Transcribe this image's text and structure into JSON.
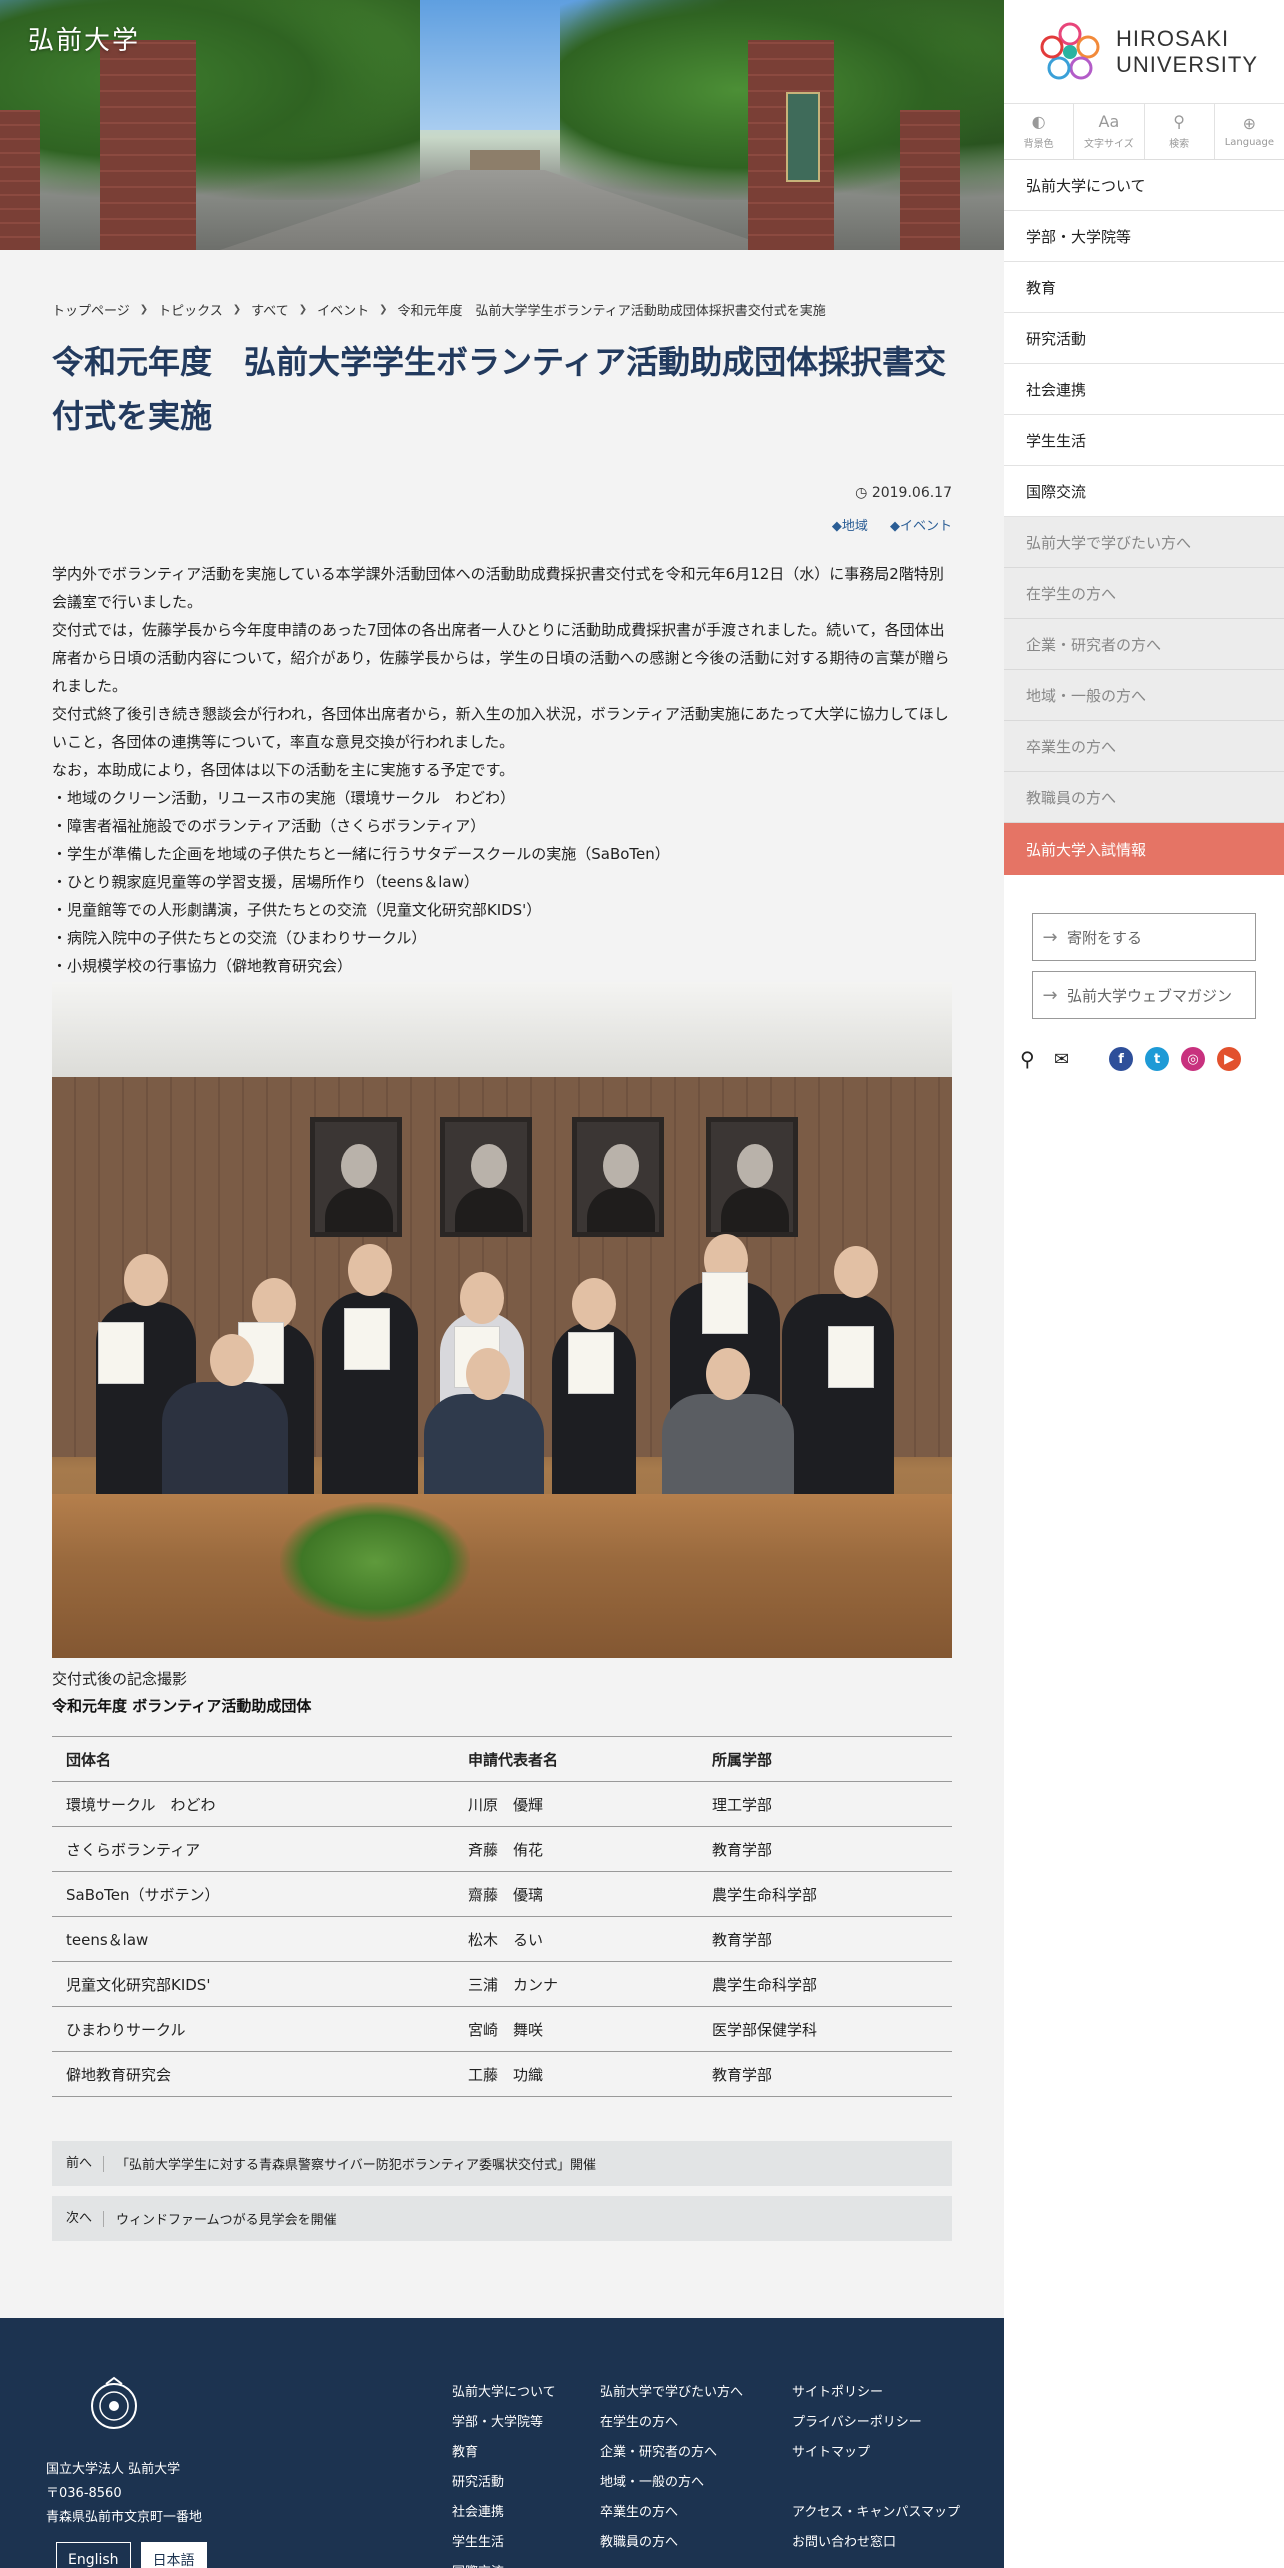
{
  "hero": {
    "site_title": "弘前大学"
  },
  "logo": {
    "line1": "HIROSAKI",
    "line2": "UNIVERSITY"
  },
  "utils": [
    {
      "label": "背景色",
      "icon": "◐"
    },
    {
      "label": "文字サイズ",
      "icon": "Aa"
    },
    {
      "label": "検索",
      "icon": "⚲"
    },
    {
      "label": "Language",
      "icon": "⊕"
    }
  ],
  "nav_main": [
    "弘前大学について",
    "学部・大学院等",
    "教育",
    "研究活動",
    "社会連携",
    "学生生活",
    "国際交流"
  ],
  "nav_sub": [
    "弘前大学で学びたい方へ",
    "在学生の方へ",
    "企業・研究者の方へ",
    "地域・一般の方へ",
    "卒業生の方へ",
    "教職員の方へ"
  ],
  "nav_exam": "弘前大学入試情報",
  "side_buttons": {
    "donate": "寄附をする",
    "magazine": "弘前大学ウェブマガジン"
  },
  "social": {
    "facebook": "f",
    "twitter": "t",
    "instagram": "◎",
    "youtube": "▶",
    "colors": {
      "facebook": "#2e4f9a",
      "twitter": "#1e9ad6",
      "instagram": "#c8317e",
      "youtube": "#e2512d"
    }
  },
  "breadcrumb": [
    "トップページ",
    "トピックス",
    "すべて",
    "イベント"
  ],
  "breadcrumb_current": "令和元年度　弘前大学学生ボランティア活動助成団体採択書交付式を実施",
  "article": {
    "title_line1": "令和元年度　弘前大学学生ボランティア活動助成団体採択書交",
    "title_line2": "付式を実施",
    "date": "2019.06.17",
    "tags": [
      "地域",
      "イベント"
    ],
    "paragraphs": [
      "学内外でボランティア活動を実施している本学課外活動団体への活動助成費採択書交付式を令和元年6月12日（水）に事務局2階特別会議室で行いました。",
      "交付式では，佐藤学長から今年度申請のあった7団体の各出席者一人ひとりに活動助成費採択書が手渡されました。続いて，各団体出席者から日頃の活動内容について，紹介があり，佐藤学長からは，学生の日頃の活動への感謝と今後の活動に対する期待の言葉が贈られました。",
      "交付式終了後引き続き懇談会が行われ，各団体出席者から，新入生の加入状況，ボランティア活動実施にあたって大学に協力してほしいこと，各団体の連携等について，率直な意見交換が行われました。",
      "なお，本助成により，各団体は以下の活動を主に実施する予定です。",
      "・地域のクリーン活動，リユース市の実施（環境サークル　わどわ）",
      "・障害者福祉施設でのボランティア活動（さくらボランティア）",
      "・学生が準備した企画を地域の子供たちと一緒に行うサタデースクールの実施（SaBoTen）",
      "・ひとり親家庭児童等の学習支援，居場所作り（teens＆law）",
      "・児童館等での人形劇講演，子供たちとの交流（児童文化研究部KIDS'）",
      "・病院入院中の子供たちとの交流（ひまわりサークル）",
      "・小規模学校の行事協力（僻地教育研究会）"
    ],
    "caption": "交付式後の記念撮影",
    "table_title": "令和元年度 ボランティア活動助成団体"
  },
  "table": {
    "headers": [
      "団体名",
      "申請代表者名",
      "所属学部"
    ],
    "rows": [
      [
        "環境サークル　わどわ",
        "川原　優輝",
        "理工学部"
      ],
      [
        "さくらボランティア",
        "斉藤　侑花",
        "教育学部"
      ],
      [
        "SaBoTen（サボテン）",
        "齋藤　優璃",
        "農学生命科学部"
      ],
      [
        "teens＆law",
        "松木　るい",
        "教育学部"
      ],
      [
        "児童文化研究部KIDS'",
        "三浦　カンナ",
        "農学生命科学部"
      ],
      [
        "ひまわりサークル",
        "宮崎　舞咲",
        "医学部保健学科"
      ],
      [
        "僻地教育研究会",
        "工藤　功織",
        "教育学部"
      ]
    ]
  },
  "pager": {
    "prev_label": "前へ",
    "prev_title": "「弘前大学学生に対する青森県警察サイバー防犯ボランティア委嘱状交付式」開催",
    "next_label": "次へ",
    "next_title": "ウィンドファームつがる見学会を開催"
  },
  "footer": {
    "org": "国立大学法人 弘前大学",
    "zip": "〒036-8560",
    "address": "青森県弘前市文京町一番地",
    "lang_en": "English",
    "lang_ja": "日本語",
    "col1": [
      "弘前大学について",
      "学部・大学院等",
      "教育",
      "研究活動",
      "社会連携",
      "学生生活",
      "国際交流"
    ],
    "col2": [
      "弘前大学で学びたい方へ",
      "在学生の方へ",
      "企業・研究者の方へ",
      "地域・一般の方へ",
      "卒業生の方へ",
      "教職員の方へ"
    ],
    "col3": [
      "サイトポリシー",
      "プライバシーポリシー",
      "サイトマップ"
    ],
    "col4": [
      "アクセス・キャンパスマップ",
      "お問い合わせ窓口"
    ]
  }
}
